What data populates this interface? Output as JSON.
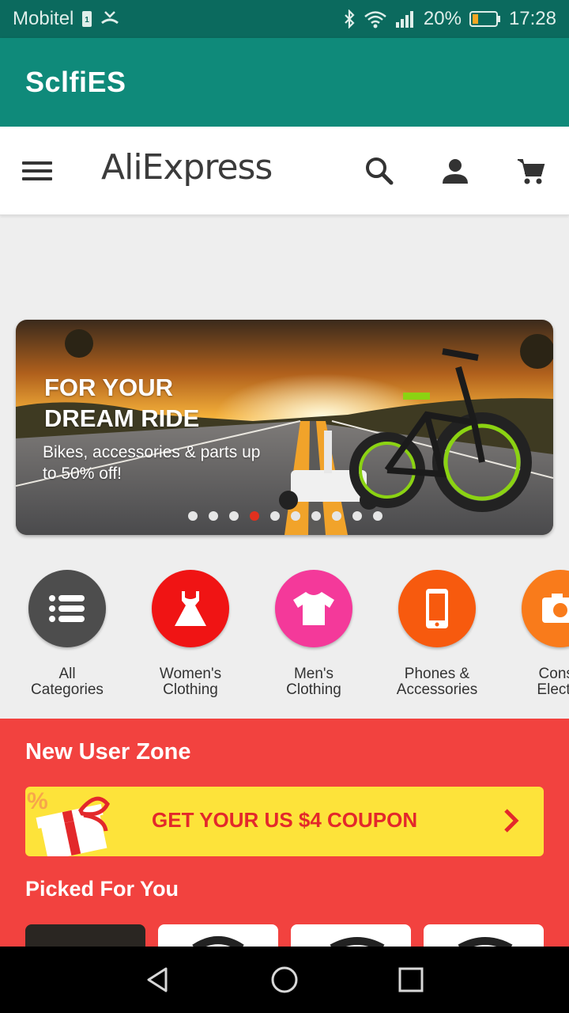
{
  "status_bar": {
    "carrier": "Mobitel",
    "battery_percent": "20%",
    "time": "17:28"
  },
  "app_bar": {
    "title": "SclfiES"
  },
  "header": {
    "logo": "AliExpress",
    "icons": [
      "menu-icon",
      "search-icon",
      "account-icon",
      "cart-icon"
    ]
  },
  "banner": {
    "headline": "FOR YOUR DREAM RIDE",
    "subtext": "Bikes, accessories & parts up to 50% off!",
    "slide_count": 10,
    "active_slide": 4
  },
  "categories": [
    {
      "label": "All\nCategories",
      "icon": "list-icon",
      "color": "#4d4d4d"
    },
    {
      "label": "Women's\nClothing",
      "icon": "dress-icon",
      "color": "#f01414"
    },
    {
      "label": "Men's\nClothing",
      "icon": "tshirt-icon",
      "color": "#f4399a"
    },
    {
      "label": "Phones &\nAccessories",
      "icon": "phone-icon",
      "color": "#f75a0e"
    },
    {
      "label": "Consu\nElectro",
      "icon": "camera-icon",
      "color": "#f97b1b"
    }
  ],
  "new_user_zone": {
    "title": "New User Zone",
    "coupon_text": "GET YOUR US $4 COUPON",
    "picked_title": "Picked For You"
  },
  "colors": {
    "status_bar": "#0b6a5e",
    "app_bar": "#0f8a7a",
    "section_red": "#f2423f",
    "coupon_yellow": "#fde33a",
    "coupon_text": "#e3282b"
  }
}
